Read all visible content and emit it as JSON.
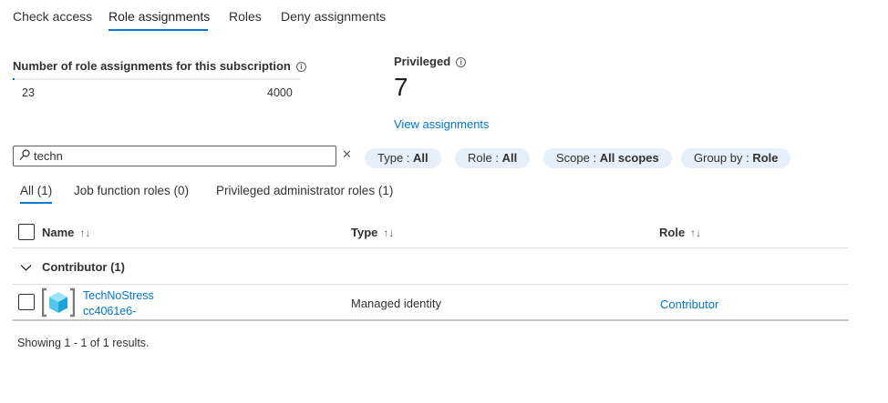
{
  "tabs": [
    {
      "label": "Check access"
    },
    {
      "label": "Role assignments",
      "active": true
    },
    {
      "label": "Roles"
    },
    {
      "label": "Deny assignments"
    }
  ],
  "summary": {
    "count_title": "Number of role assignments for this subscription",
    "current": "23",
    "limit": "4000",
    "usage_fraction": 0.00575,
    "privileged_title": "Privileged",
    "privileged_count": "7",
    "view_link": "View assignments"
  },
  "search": {
    "value": "techn",
    "clear": "✕"
  },
  "filters": [
    {
      "key": "Type : ",
      "value": "All"
    },
    {
      "key": "Role : ",
      "value": "All"
    },
    {
      "key": "Scope : ",
      "value": "All scopes"
    },
    {
      "key": "Group by : ",
      "value": "Role"
    }
  ],
  "subtabs": [
    {
      "label": "All (1)",
      "active": true
    },
    {
      "label": "Job function roles (0)"
    },
    {
      "label": "Privileged administrator roles (1)"
    }
  ],
  "table": {
    "headers": {
      "name": "Name",
      "type": "Type",
      "role": "Role"
    },
    "sort_glyph": "↑↓",
    "group": {
      "label": "Contributor (1)"
    },
    "rows": [
      {
        "name": "TechNoStress",
        "id": "cc4061e6-",
        "type": "Managed identity",
        "role": "Contributor"
      }
    ]
  },
  "footer": "Showing 1 - 1 of 1 results.",
  "colors": {
    "accent": "#0078d4",
    "pill_bg": "#e6f0fa",
    "text": "#323130"
  }
}
